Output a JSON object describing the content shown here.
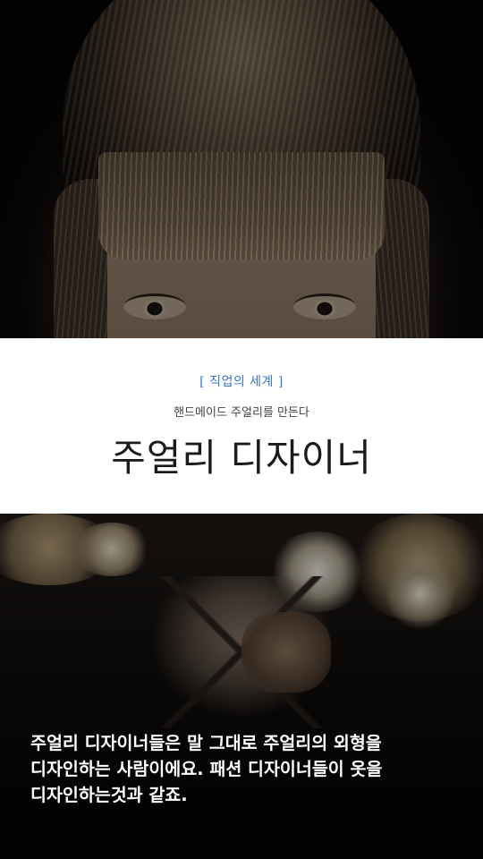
{
  "header": {
    "category": "[ 직업의 세계 ]",
    "subtitle": "핸드메이드 주얼리를 만든다",
    "title": "주얼리 디자이너"
  },
  "body": {
    "description": "주얼리 디자이너들은 말 그대로 주얼리의 외형을 디자인하는 사람이에요. 패션 디자이너들이 옷을 디자인하는것과 같죠."
  },
  "colors": {
    "category_accent": "#3a72c4",
    "title_text": "#1b1b1b",
    "band_background": "#ffffff",
    "description_text": "#ffffff"
  }
}
